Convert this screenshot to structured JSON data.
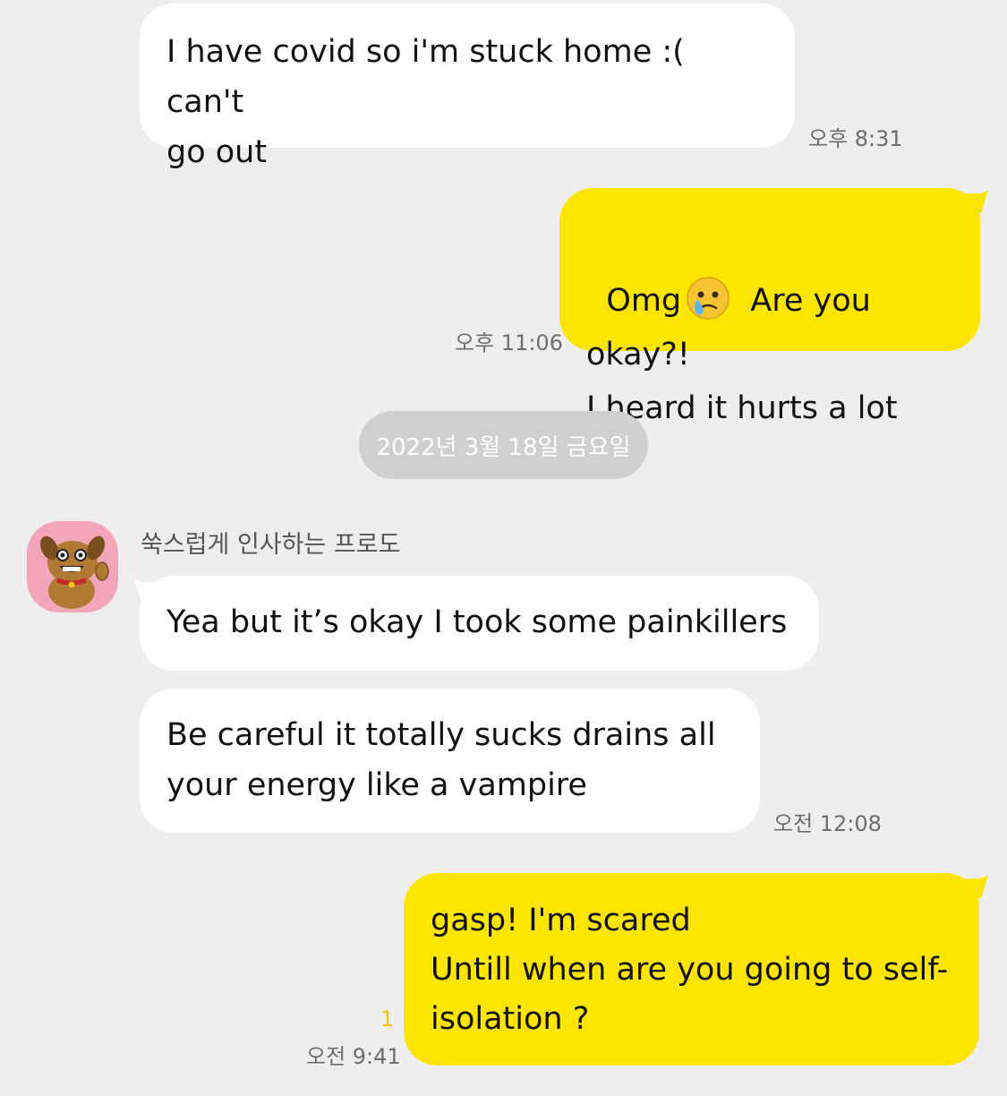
{
  "messages": [
    {
      "text": "I have covid so i'm stuck home :( can't\ngo out",
      "time": "오후 8:31"
    },
    {
      "text_line1": "Omg",
      "text_line1_rest": " Are you okay?!",
      "text_line2": "I heard it hurts a lot",
      "emoji": "crying-face-emoji",
      "time": "오후 11:06"
    },
    {
      "text": "Yea but it’s okay I took some painkillers"
    },
    {
      "text": "Be careful it totally sucks drains all\nyour energy like a vampire",
      "time": "오전 12:08"
    },
    {
      "text": "gasp! I'm scared\nUntill when are you going to self-\nisolation ?",
      "time": "오전 9:41",
      "unread": "1"
    }
  ],
  "date_divider": "2022년 3월 18일 금요일",
  "sender_name": "쑥스럽게 인사하는 프로도",
  "colors": {
    "background": "#eeeeee",
    "incoming_bubble": "#ffffff",
    "outgoing_bubble": "#fee500",
    "date_pill": "#d0d0d0",
    "avatar_bg": "#f3a6b9",
    "unread": "#f5c400"
  }
}
